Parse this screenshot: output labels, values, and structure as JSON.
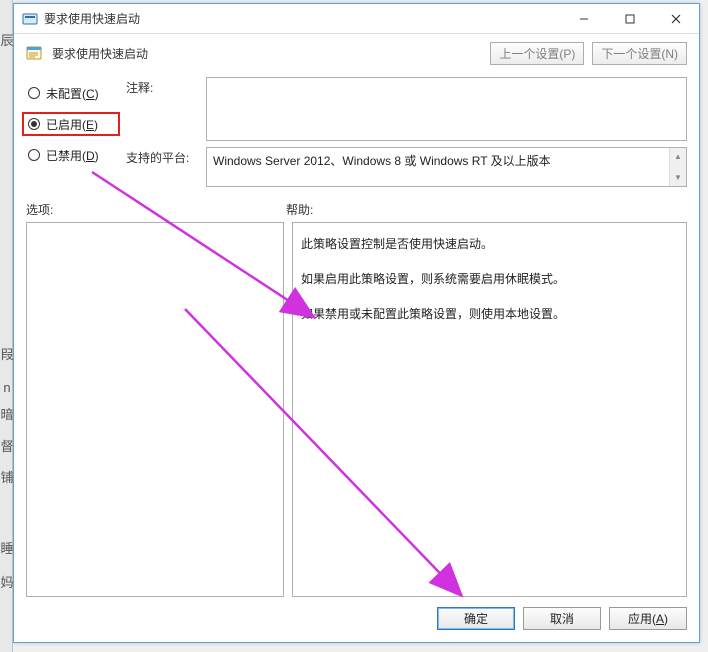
{
  "leftStripChars": [
    "辰",
    "叚",
    "n",
    "暗",
    "督",
    "铺",
    "睡",
    "妈"
  ],
  "titlebar": {
    "title": "要求使用快速启动"
  },
  "header": {
    "policyTitle": "要求使用快速启动",
    "prevBtn": "上一个设置(P)",
    "nextBtn": "下一个设置(N)"
  },
  "radios": {
    "notConfigured": {
      "label": "未配置(",
      "accel": "C",
      "suffix": ")"
    },
    "enabled": {
      "label": "已启用(",
      "accel": "E",
      "suffix": ")"
    },
    "disabled": {
      "label": "已禁用(",
      "accel": "D",
      "suffix": ")"
    }
  },
  "fields": {
    "commentLabel": "注释:",
    "commentValue": "",
    "platformLabel": "支持的平台:",
    "platformValue": "Windows Server 2012、Windows 8 或 Windows RT 及以上版本"
  },
  "midLabels": {
    "options": "选项:",
    "help": "帮助:"
  },
  "help": {
    "line1": "此策略设置控制是否使用快速启动。",
    "line2": "如果启用此策略设置，则系统需要启用休眠模式。",
    "line3": "如果禁用或未配置此策略设置，则使用本地设置。"
  },
  "footer": {
    "ok": "确定",
    "cancel": "取消",
    "applyLabel": "应用(",
    "applyAccel": "A",
    "applySuffix": ")"
  },
  "annotations": {
    "arrowColor": "#d032e0"
  }
}
